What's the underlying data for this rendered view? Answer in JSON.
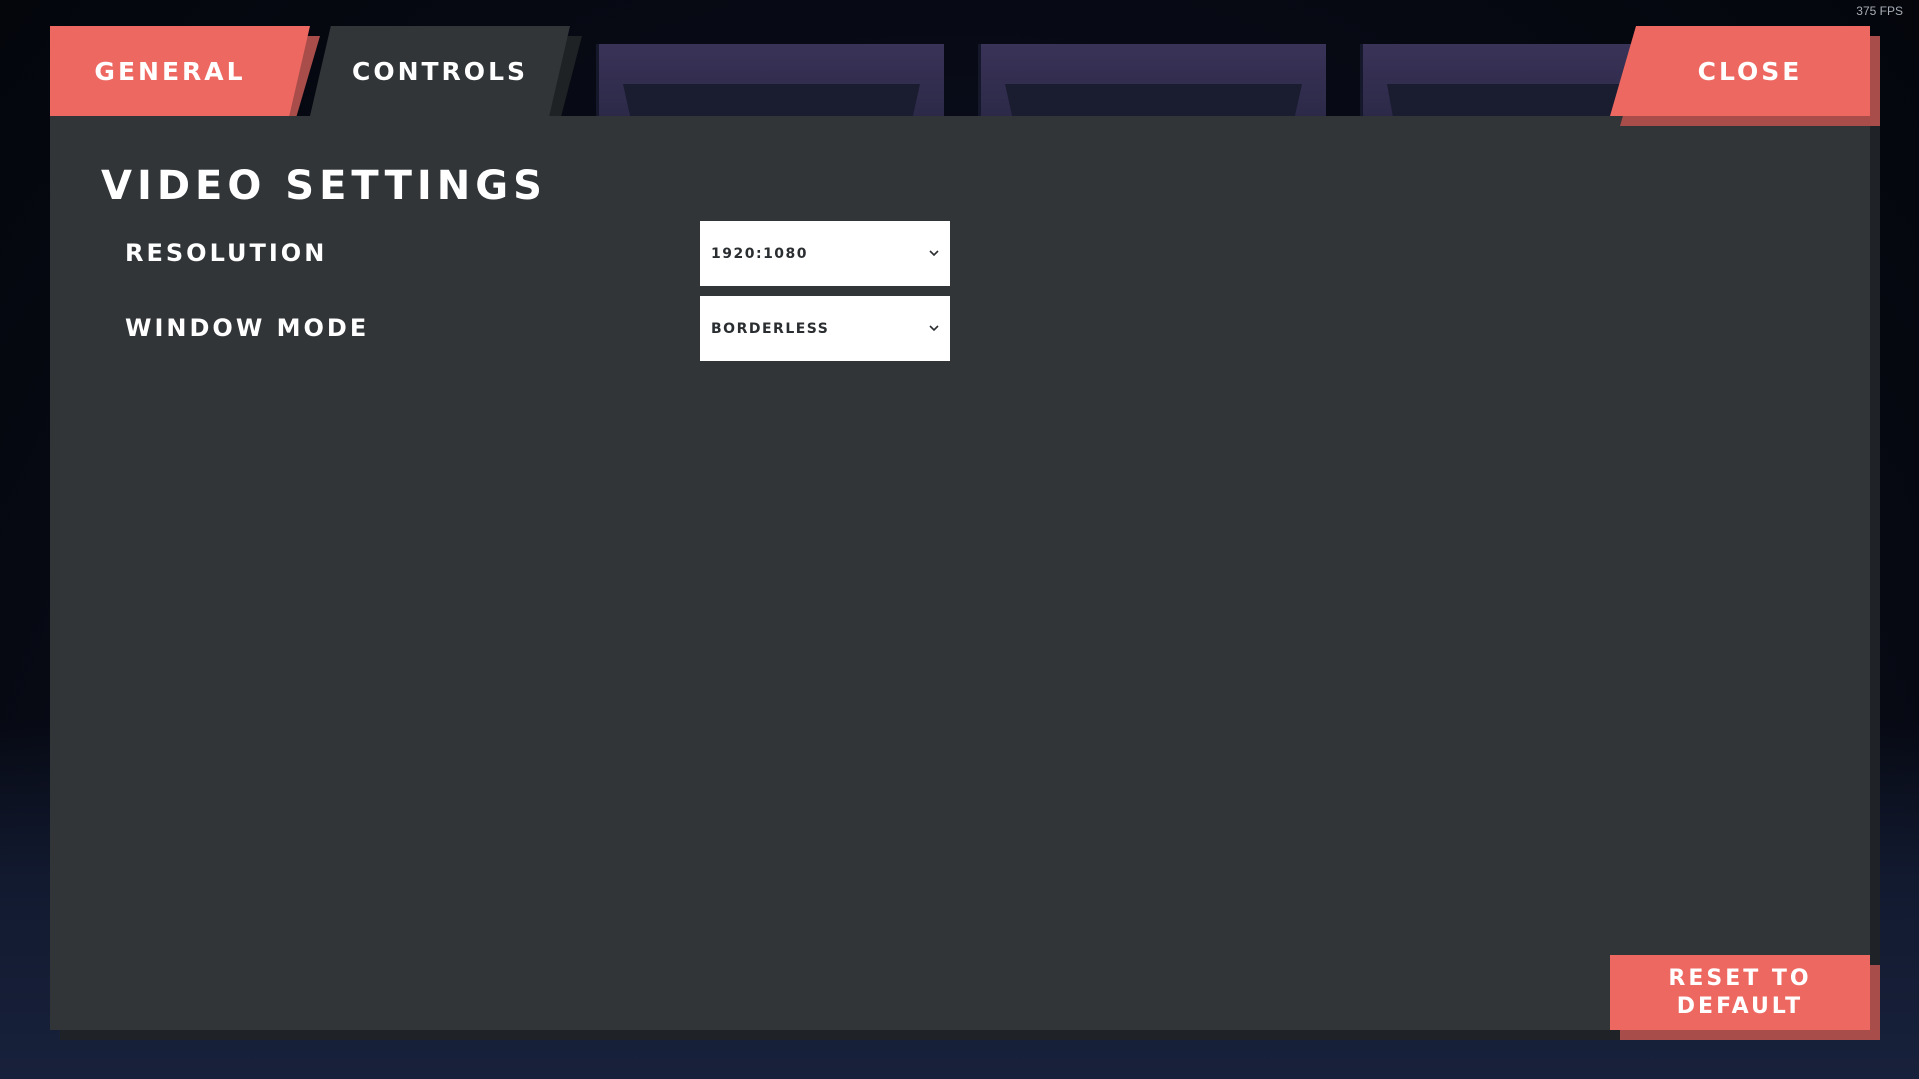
{
  "fps": "375 FPS",
  "tabs": {
    "general": "General",
    "controls": "Controls",
    "close": "Close"
  },
  "section": {
    "title": "Video Settings"
  },
  "settings": [
    {
      "label": "Resolution",
      "value": "1920:1080"
    },
    {
      "label": "Window Mode",
      "value": "Borderless"
    }
  ],
  "footer": {
    "reset_label": "Reset to Default"
  },
  "colors": {
    "accent": "#ee6862",
    "panel": "#313538",
    "dropdown_bg": "#ffffff",
    "text": "#ffffff"
  },
  "icons": {
    "dropdown_arrow": "chevron-down-icon"
  }
}
